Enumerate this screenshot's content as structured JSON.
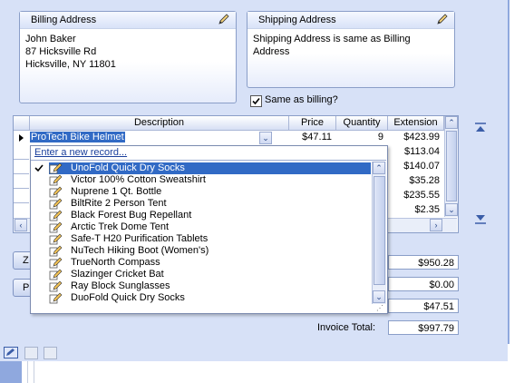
{
  "billing": {
    "title": "Billing Address",
    "name": "John Baker",
    "street": "87 Hicksville Rd",
    "city": "Hicksville, NY 11801"
  },
  "shipping": {
    "title": "Shipping Address",
    "text": "Shipping Address is same as Billing Address"
  },
  "same_as_billing": {
    "label": "Same as billing?",
    "checked": true
  },
  "grid": {
    "columns": [
      "Description",
      "Price",
      "Quantity",
      "Extension"
    ],
    "current_row": {
      "description": "ProTech Bike Helmet",
      "price": "$47.11",
      "quantity": "9",
      "extension": "$423.99"
    },
    "extensions": [
      "$113.04",
      "$140.07",
      "$35.28",
      "$235.55",
      "$2.35"
    ]
  },
  "dropdown": {
    "new_record": "Enter a new record...",
    "items": [
      "UnoFold Quick Dry Socks",
      "Victor 100% Cotton  Sweatshirt",
      "Nuprene 1 Qt. Bottle",
      "BiltRite 2 Person Tent",
      "Black Forest Bug Repellant",
      "Arctic Trek Dome Tent",
      "Safe-T H20 Purification Tablets",
      "NuTech Hiking Boot (Women's)",
      "TrueNorth Compass",
      "Slazinger Cricket Bat",
      "Ray Block Sunglasses",
      "DuoFold Quick Dry Socks"
    ],
    "selected_index": 0
  },
  "buttons": {
    "z_label": "Z",
    "p_label": "P"
  },
  "totals": {
    "subtotal": "$950.28",
    "second": "$0.00",
    "third": "$47.51",
    "invoice_label": "Invoice Total:",
    "invoice_total": "$997.79"
  },
  "colors": {
    "selection": "#316ac5",
    "panel_bg": "#d7e1f7",
    "border": "#8a9ec8"
  }
}
